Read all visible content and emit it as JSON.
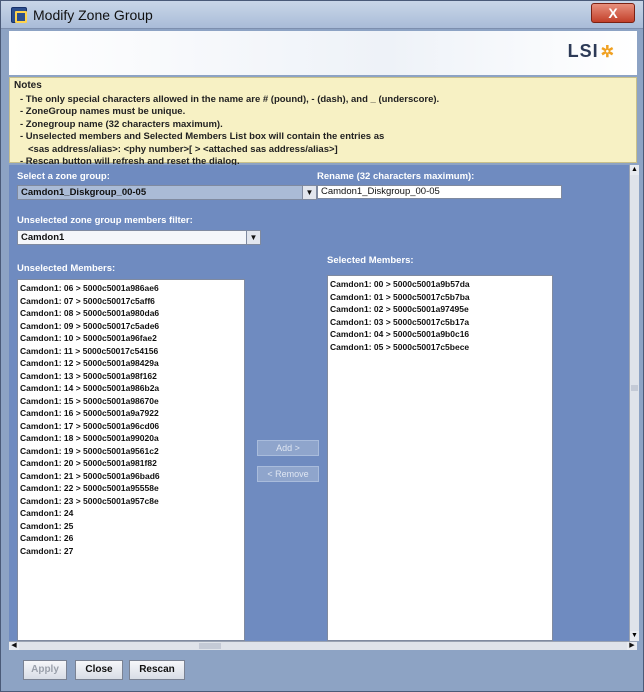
{
  "window": {
    "title": "Modify Zone Group",
    "close_label": "X"
  },
  "brand": {
    "logo_text": "LSI",
    "logo_star": "✲"
  },
  "notes": {
    "title": "Notes",
    "lines": [
      "- The only special characters allowed in the name are # (pound), - (dash), and _ (underscore).",
      "- ZoneGroup names must be unique.",
      "- Zonegroup name (32 characters maximum).",
      "- Unselected members and Selected Members List box will contain the entries as",
      "   <sas address/alias>: <phy number>[ > <attached sas address/alias>]",
      "- Rescan button will refresh and reset the dialog."
    ]
  },
  "zone_group": {
    "label": "Select a zone group:",
    "value": "Camdon1_Diskgroup_00-05"
  },
  "rename": {
    "label": "Rename (32 characters maximum):",
    "value": "Camdon1_Diskgroup_00-05"
  },
  "filter": {
    "label": "Unselected zone group members filter:",
    "value": "Camdon1"
  },
  "unselected": {
    "label": "Unselected Members:",
    "items": [
      "Camdon1: 06 > 5000c5001a986ae6",
      "Camdon1: 07 > 5000c50017c5aff6",
      "Camdon1: 08 > 5000c5001a980da6",
      "Camdon1: 09 > 5000c50017c5ade6",
      "Camdon1: 10 > 5000c5001a96fae2",
      "Camdon1: 11 > 5000c50017c54156",
      "Camdon1: 12 > 5000c5001a98429a",
      "Camdon1: 13 > 5000c5001a98f162",
      "Camdon1: 14 > 5000c5001a986b2a",
      "Camdon1: 15 > 5000c5001a98670e",
      "Camdon1: 16 > 5000c5001a9a7922",
      "Camdon1: 17 > 5000c5001a96cd06",
      "Camdon1: 18 > 5000c5001a99020a",
      "Camdon1: 19 > 5000c5001a9561c2",
      "Camdon1: 20 > 5000c5001a981f82",
      "Camdon1: 21 > 5000c5001a96bad6",
      "Camdon1: 22 > 5000c5001a95558e",
      "Camdon1: 23 > 5000c5001a957c8e",
      "Camdon1: 24",
      "Camdon1: 25",
      "Camdon1: 26",
      "Camdon1: 27"
    ]
  },
  "selected": {
    "label": "Selected Members:",
    "items": [
      "Camdon1: 00 > 5000c5001a9b57da",
      "Camdon1: 01 > 5000c50017c5b7ba",
      "Camdon1: 02 > 5000c5001a97495e",
      "Camdon1: 03 > 5000c50017c5b17a",
      "Camdon1: 04 > 5000c5001a9b0c16",
      "Camdon1: 05 > 5000c50017c5bece"
    ]
  },
  "actions": {
    "add_label": "Add >",
    "remove_label": "< Remove"
  },
  "footer": {
    "apply_label": "Apply",
    "close_label": "Close",
    "rescan_label": "Rescan"
  }
}
